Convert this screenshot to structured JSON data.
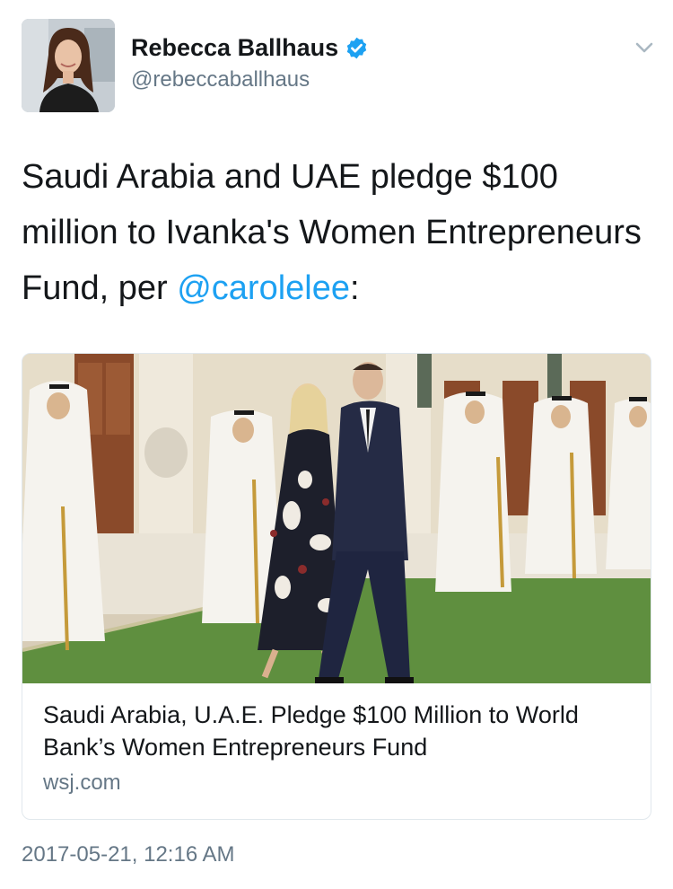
{
  "author": {
    "display_name": "Rebecca Ballhaus",
    "handle": "@rebeccaballhaus",
    "verified_icon": "verified-badge-icon"
  },
  "tweet": {
    "text_before_mention": "Saudi Arabia and UAE pledge $100 million to Ivanka's Women Entrepreneurs Fund, per ",
    "mention": "@carolelee",
    "text_after_mention": ":",
    "timestamp": "2017-05-21, 12:16 AM"
  },
  "card": {
    "title": "Saudi Arabia, U.A.E. Pledge $100 Million to World Bank’s Women Entrepreneurs Fund",
    "domain": "wsj.com"
  },
  "colors": {
    "link": "#1da1f2",
    "secondary_text": "#657786",
    "border": "#e1e8ed"
  }
}
